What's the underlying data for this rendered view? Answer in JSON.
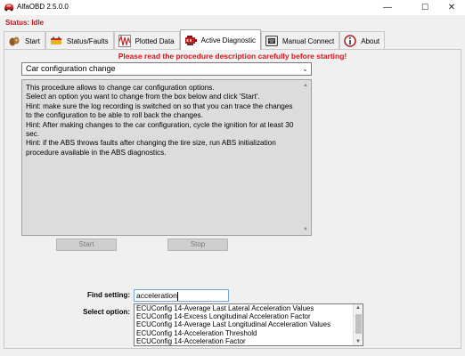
{
  "window": {
    "title": "AlfaOBD 2.5.0.0",
    "minimize": "—",
    "maximize": "☐",
    "close": "✕"
  },
  "status": {
    "text": "Status: Idle"
  },
  "tabs": [
    {
      "label": "Start",
      "icon": "start-icon"
    },
    {
      "label": "Status/Faults",
      "icon": "battery-icon"
    },
    {
      "label": "Plotted Data",
      "icon": "waveform-icon"
    },
    {
      "label": "Active Diagnostic",
      "icon": "engine-icon",
      "active": true
    },
    {
      "label": "Manual Connect",
      "icon": "connector-icon"
    },
    {
      "label": "About",
      "icon": "info-icon"
    }
  ],
  "active_diagnostic": {
    "warning": "Please read the procedure description carefully before starting!",
    "procedure_select": {
      "value": "Car configuration change"
    },
    "description": [
      "This procedure allows to change car configuration options.",
      "Select an option you want to change from the box below and click 'Start'.",
      "Hint: make sure the log recording is switched on so that you can trace the changes to the configuration to be able to roll back the changes.",
      "Hint: After making changes to the car configuration, cycle the ignition for at least 30 sec.",
      "Hint: if the ABS throws faults after changing the tire size, run ABS initialization procedure available in the ABS diagnostics."
    ],
    "start_label": "Start",
    "stop_label": "Stop",
    "find_setting": {
      "label": "Find setting:",
      "value": "acceleration"
    },
    "select_option": {
      "label": "Select option:",
      "options": [
        "ECUConfig 14-Average Last Lateral Acceleration Values",
        "ECUConfig 14-Excess Longitudinal Acceleration Factor",
        "ECUConfig 14-Average Last Longitudinal Acceleration Values",
        "ECUConfig 14-Acceleration Threshold",
        "ECUConfig 14-Acceleration Factor"
      ]
    }
  },
  "colors": {
    "status_red": "#c0161b",
    "warning_red": "#d7141a",
    "description_bg": "#dcdcdc",
    "disabled_button": "#cfcfcf"
  }
}
